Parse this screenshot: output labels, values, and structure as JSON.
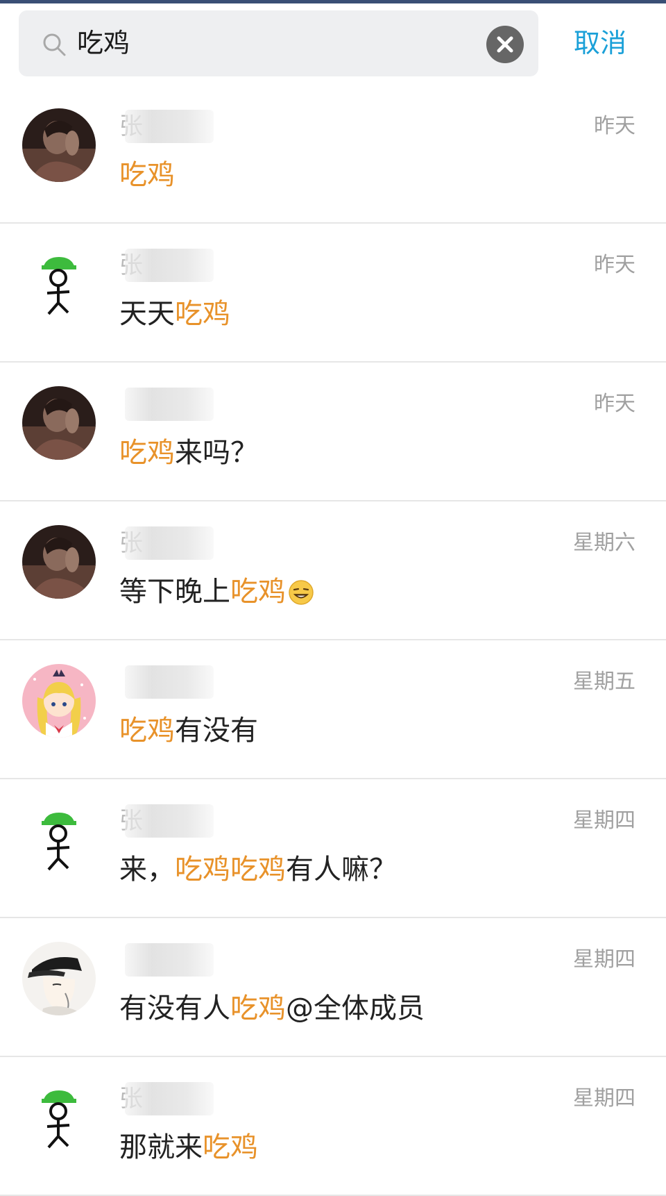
{
  "search": {
    "query": "吃鸡",
    "cancel_label": "取消"
  },
  "results": [
    {
      "sender": "张",
      "date": "昨天",
      "avatar": "photo",
      "segments": [
        {
          "text": "吃鸡",
          "hl": true
        }
      ]
    },
    {
      "sender": "张",
      "date": "昨天",
      "avatar": "stickman",
      "segments": [
        {
          "text": "天天"
        },
        {
          "text": "吃鸡",
          "hl": true
        }
      ]
    },
    {
      "sender": "",
      "date": "昨天",
      "avatar": "photo",
      "segments": [
        {
          "text": "吃鸡",
          "hl": true
        },
        {
          "text": "来吗？"
        }
      ]
    },
    {
      "sender": "张",
      "date": "星期六",
      "avatar": "photo",
      "segments": [
        {
          "text": "等下晚上"
        },
        {
          "text": "吃鸡",
          "hl": true
        }
      ],
      "emoji": "grin-emoji"
    },
    {
      "sender": "",
      "date": "星期五",
      "avatar": "anime-girl",
      "segments": [
        {
          "text": "吃鸡",
          "hl": true
        },
        {
          "text": "有没有"
        }
      ]
    },
    {
      "sender": "张",
      "date": "星期四",
      "avatar": "stickman",
      "segments": [
        {
          "text": "来，"
        },
        {
          "text": "吃鸡吃鸡",
          "hl": true
        },
        {
          "text": "有人嘛？"
        }
      ]
    },
    {
      "sender": "",
      "date": "星期四",
      "avatar": "cap-boy",
      "segments": [
        {
          "text": "有没有人"
        },
        {
          "text": "吃鸡",
          "hl": true
        },
        {
          "text": "@全体成员"
        }
      ]
    },
    {
      "sender": "张",
      "date": "星期四",
      "avatar": "stickman",
      "segments": [
        {
          "text": "那就来"
        },
        {
          "text": "吃鸡",
          "hl": true
        }
      ]
    }
  ],
  "colors": {
    "highlight": "#e8922a",
    "cancel": "#1aa0d8",
    "top_strip": "#3a4f75"
  }
}
